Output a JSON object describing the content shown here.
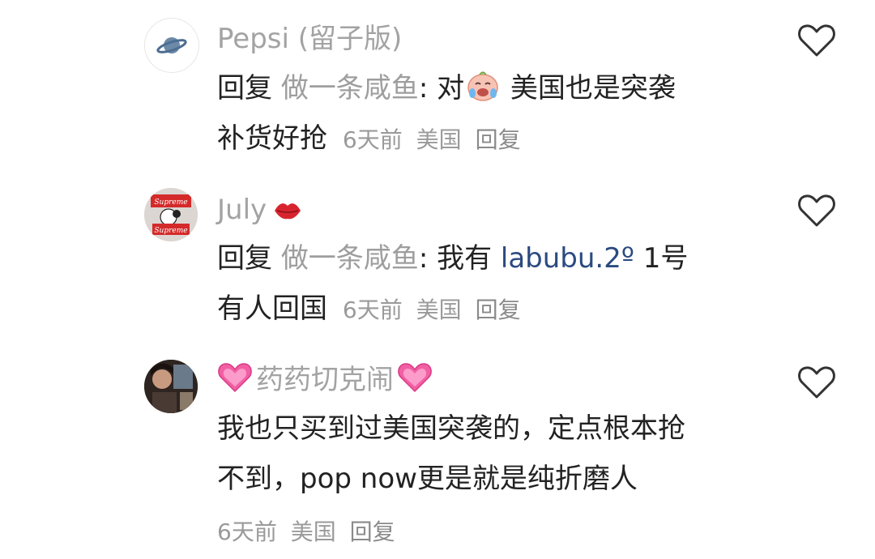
{
  "comments": [
    {
      "username": "Pepsi (留子版)",
      "line1": {
        "reply_prefix": "回复",
        "reply_target": "做一条咸鱼",
        "colon": ": ",
        "text_a": "对",
        "emoji": "crying-baby-face",
        "text_b": " 美国也是突袭"
      },
      "line2": {
        "text": "补货好抢"
      },
      "meta": {
        "time": "6天前",
        "location": "美国",
        "reply": "回复"
      }
    },
    {
      "username": "July",
      "username_emoji": "lips-kiss",
      "line1": {
        "reply_prefix": "回复",
        "reply_target": "做一条咸鱼",
        "colon": ": ",
        "text_a": "我有 ",
        "mention": "labubu.2º",
        "text_b": " 1号"
      },
      "line2": {
        "text": "有人回国"
      },
      "meta": {
        "time": "6天前",
        "location": "美国",
        "reply": "回复"
      }
    },
    {
      "username": "药药切克闹",
      "username_emoji": "pink-heart",
      "line1": {
        "text": "我也只买到过美国突袭的，定点根本抢"
      },
      "line2": {
        "text": "不到，pop now更是就是纯折磨人"
      },
      "meta": {
        "time": "6天前",
        "location": "美国",
        "reply": "回复"
      }
    }
  ],
  "colors": {
    "username": "#a3a3a3",
    "body": "#222222",
    "meta": "#9a9a9a",
    "mention": "#2b4a80",
    "heart": "#333333"
  },
  "icons": {
    "like": "heart-outline-icon",
    "avatar1": "planet-icon"
  }
}
